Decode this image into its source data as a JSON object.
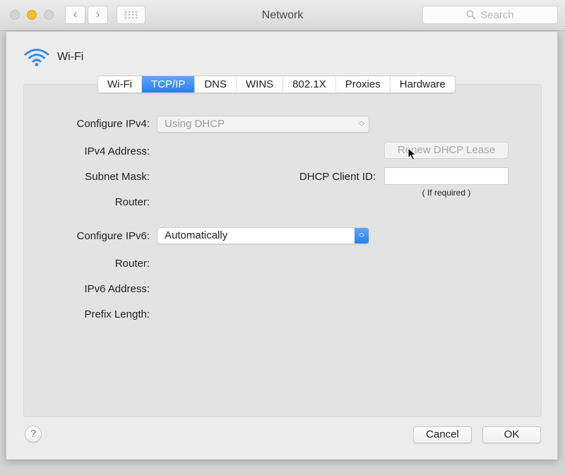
{
  "window": {
    "title": "Network",
    "search_placeholder": "Search"
  },
  "header": {
    "service_name": "Wi-Fi",
    "icon": "wifi-icon"
  },
  "tabs": [
    {
      "label": "Wi-Fi",
      "active": false
    },
    {
      "label": "TCP/IP",
      "active": true
    },
    {
      "label": "DNS",
      "active": false
    },
    {
      "label": "WINS",
      "active": false
    },
    {
      "label": "802.1X",
      "active": false
    },
    {
      "label": "Proxies",
      "active": false
    },
    {
      "label": "Hardware",
      "active": false
    }
  ],
  "ipv4": {
    "configure_label": "Configure IPv4:",
    "configure_value": "Using DHCP",
    "address_label": "IPv4 Address:",
    "subnet_label": "Subnet Mask:",
    "router_label": "Router:",
    "renew_button": "Renew DHCP Lease",
    "client_id_label": "DHCP Client ID:",
    "client_id_value": "",
    "client_id_hint": "( If required )"
  },
  "ipv6": {
    "configure_label": "Configure IPv6:",
    "configure_value": "Automatically",
    "router_label": "Router:",
    "address_label": "IPv6 Address:",
    "prefix_label": "Prefix Length:"
  },
  "footer": {
    "help": "?",
    "cancel": "Cancel",
    "ok": "OK"
  },
  "colors": {
    "accent": "#2a7ef0",
    "minimize": "#f5bf2e"
  }
}
